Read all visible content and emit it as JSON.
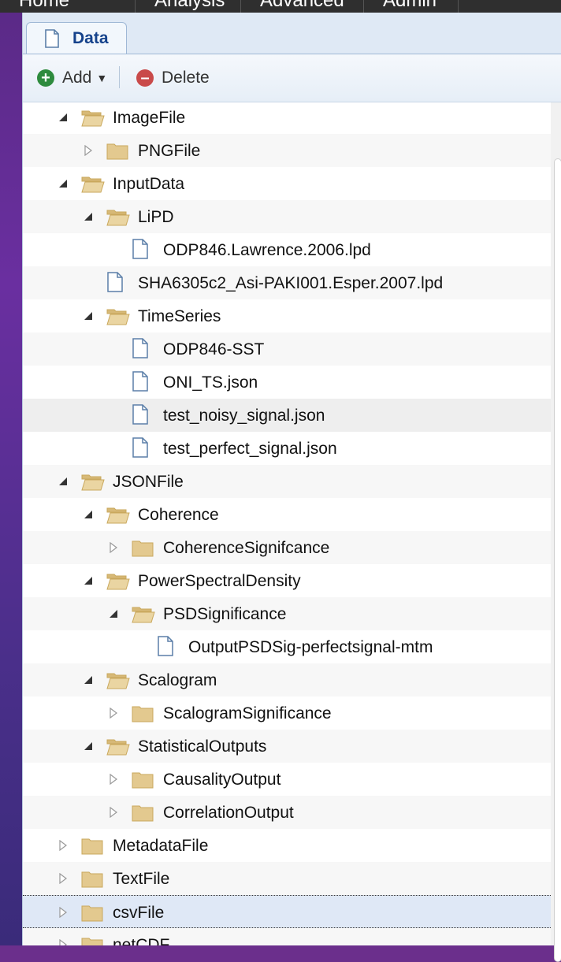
{
  "topnav": {
    "tabs": [
      "Home",
      "Analysis",
      "Advanced",
      "Admin"
    ]
  },
  "tab": {
    "label": "Data"
  },
  "toolbar": {
    "add_label": "Add",
    "delete_label": "Delete",
    "add_color": "#2e8b3e",
    "delete_color": "#c94a4a"
  },
  "colors": {
    "folder": "#e3c98f",
    "folder_dark": "#c9a85d",
    "file_stroke": "#5b7fa8",
    "selected_row": "#dfe8f6"
  },
  "tree": {
    "rows": [
      {
        "label": "ImageFile",
        "type": "folder",
        "depth": 1,
        "expanded": true
      },
      {
        "label": "PNGFile",
        "type": "folder",
        "depth": 2,
        "expanded": false
      },
      {
        "label": "InputData",
        "type": "folder",
        "depth": 1,
        "expanded": true
      },
      {
        "label": "LiPD",
        "type": "folder",
        "depth": 2,
        "expanded": true
      },
      {
        "label": "ODP846.Lawrence.2006.lpd",
        "type": "file",
        "depth": 3
      },
      {
        "label": "SHA6305c2_Asi-PAKI001.Esper.2007.lpd",
        "type": "file",
        "depth": 2
      },
      {
        "label": "TimeSeries",
        "type": "folder",
        "depth": 2,
        "expanded": true
      },
      {
        "label": "ODP846-SST",
        "type": "file",
        "depth": 3
      },
      {
        "label": "ONI_TS.json",
        "type": "file",
        "depth": 3
      },
      {
        "label": "test_noisy_signal.json",
        "type": "file",
        "depth": 3,
        "hover": true
      },
      {
        "label": "test_perfect_signal.json",
        "type": "file",
        "depth": 3
      },
      {
        "label": "JSONFile",
        "type": "folder",
        "depth": 1,
        "expanded": true
      },
      {
        "label": "Coherence",
        "type": "folder",
        "depth": 2,
        "expanded": true
      },
      {
        "label": "CoherenceSignifcance",
        "type": "folder",
        "depth": 3,
        "expanded": false
      },
      {
        "label": "PowerSpectralDensity",
        "type": "folder",
        "depth": 2,
        "expanded": true
      },
      {
        "label": "PSDSignificance",
        "type": "folder",
        "depth": 3,
        "expanded": true
      },
      {
        "label": "OutputPSDSig-perfectsignal-mtm",
        "type": "file",
        "depth": 4
      },
      {
        "label": "Scalogram",
        "type": "folder",
        "depth": 2,
        "expanded": true
      },
      {
        "label": "ScalogramSignificance",
        "type": "folder",
        "depth": 3,
        "expanded": false
      },
      {
        "label": "StatisticalOutputs",
        "type": "folder",
        "depth": 2,
        "expanded": true
      },
      {
        "label": "CausalityOutput",
        "type": "folder",
        "depth": 3,
        "expanded": false
      },
      {
        "label": "CorrelationOutput",
        "type": "folder",
        "depth": 3,
        "expanded": false
      },
      {
        "label": "MetadataFile",
        "type": "folder",
        "depth": 1,
        "expanded": false
      },
      {
        "label": "TextFile",
        "type": "folder",
        "depth": 1,
        "expanded": false
      },
      {
        "label": "csvFile",
        "type": "folder",
        "depth": 1,
        "expanded": false,
        "selected": true
      },
      {
        "label": "netCDF",
        "type": "folder",
        "depth": 1,
        "expanded": false
      }
    ]
  }
}
